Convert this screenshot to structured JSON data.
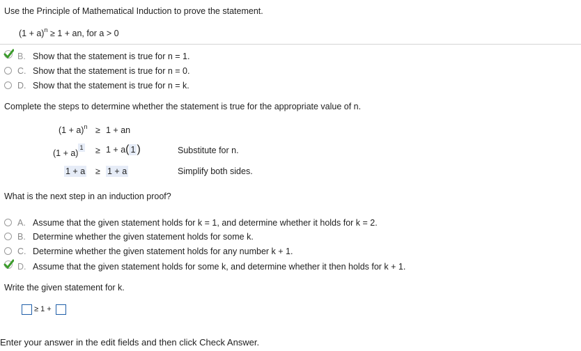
{
  "instruction": "Use the Principle of Mathematical Induction to prove the statement.",
  "statement": {
    "lhs": "(1 + a)",
    "exp": "n",
    "rhs": "≥ 1 + an, for a > 0"
  },
  "q1": {
    "options": [
      {
        "letter": "B.",
        "text": "Show that the statement is true for n = 1.",
        "selected": true
      },
      {
        "letter": "C.",
        "text": "Show that the statement is true for n = 0.",
        "selected": false
      },
      {
        "letter": "D.",
        "text": "Show that the statement is true for n = k.",
        "selected": false
      }
    ]
  },
  "complete_steps": "Complete the steps to determine whether the statement is true for the appropriate value of n.",
  "steps": {
    "row1": {
      "lhs": "(1 + a)",
      "exp": "n",
      "op": "≥",
      "rhs": "1 + an"
    },
    "row2": {
      "lhs": "(1 + a)",
      "exp": "1",
      "op": "≥",
      "rhs_pre": "1 + a",
      "rhs_val": "1",
      "note": "Substitute for n."
    },
    "row3": {
      "lhs": "1 + a",
      "op": "≥",
      "rhs": "1 + a",
      "note": "Simplify both sides."
    }
  },
  "next_step_q": "What is the next step in an induction proof?",
  "q2": {
    "options": [
      {
        "letter": "A.",
        "text": "Assume that the given statement holds for k = 1, and determine whether it holds for k = 2.",
        "selected": false
      },
      {
        "letter": "B.",
        "text": "Determine whether the given statement holds for some k.",
        "selected": false
      },
      {
        "letter": "C.",
        "text": "Determine whether the given statement holds for any number k + 1.",
        "selected": false
      },
      {
        "letter": "D.",
        "text": "Assume that the given statement holds for some k, and determine whether it then holds for k + 1.",
        "selected": true
      }
    ]
  },
  "write_statement": "Write the given statement for k.",
  "answer": {
    "middle": "≥ 1 +",
    "box1_value": "",
    "box2_value": ""
  },
  "footer": "Enter your answer in the edit fields and then click Check Answer.",
  "colors": {
    "check": "#3a9b2a",
    "box_border": "#1f5ea8",
    "highlight": "#e6ecf7"
  }
}
